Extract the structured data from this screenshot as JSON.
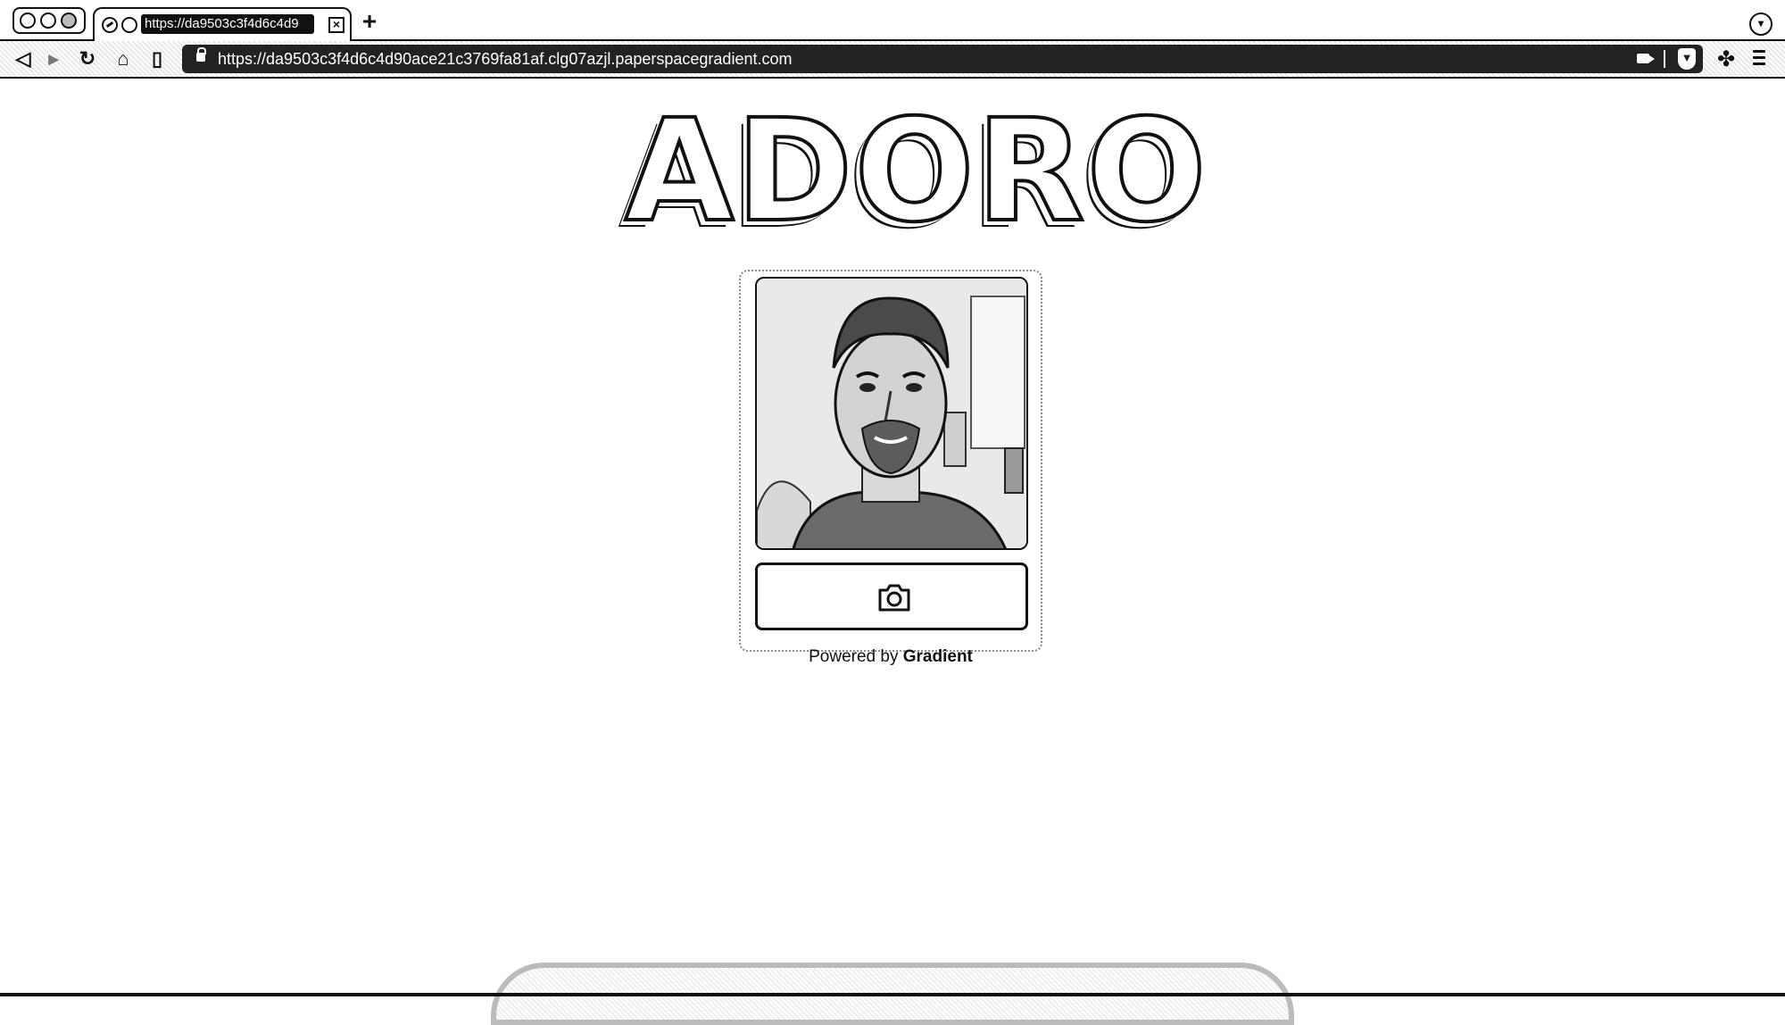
{
  "browser": {
    "tab": {
      "title": "https://da9503c3f4d6c4d9"
    },
    "toolbar": {
      "url": "https://da9503c3f4d6c4d90ace21c3769fa81af.clg07azjl.paperspacegradient.com"
    },
    "icons": {
      "back": "back-icon",
      "forward": "forward-icon",
      "reload": "reload-icon",
      "home": "home-icon",
      "bookmark": "bookmark-icon",
      "lock": "lock-icon",
      "camera": "camera-permission-icon",
      "shield": "brave-shield-icon",
      "extensions": "puzzle-icon",
      "menu": "menu-icon"
    }
  },
  "page": {
    "logo_text": "ADORO",
    "capture_button_icon": "camera-icon",
    "powered_by_prefix": "Powered by",
    "powered_by_brand": "Gradient"
  },
  "colors": {
    "ink": "#111111",
    "background": "#ffffff",
    "urlbar": "#222222"
  }
}
